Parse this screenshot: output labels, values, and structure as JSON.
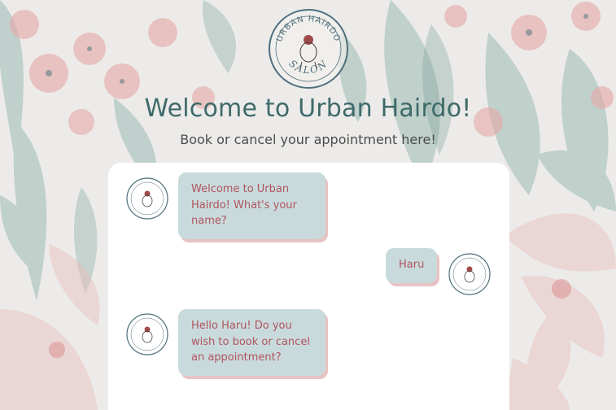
{
  "header": {
    "title": "Welcome to Urban Hairdo!",
    "subtitle": "Book or cancel your appointment here!"
  },
  "logo": {
    "top_text": "URBAN HAIRDO",
    "bottom_text": "SALON"
  },
  "messages": [
    {
      "sender": "bot",
      "text": "Welcome to Urban Hairdo! What's your name?"
    },
    {
      "sender": "user",
      "text": "Haru"
    },
    {
      "sender": "bot",
      "text": "Hello Haru! Do you wish to book or cancel an appointment?"
    }
  ],
  "colors": {
    "title": "#3e6a6a",
    "bubble_bg": "#c9dadc",
    "bubble_text": "#b0555e",
    "bubble_shadow": "#e7c3c3",
    "logo_ring": "#4f6f7c",
    "logo_accent": "#a04a4a"
  }
}
